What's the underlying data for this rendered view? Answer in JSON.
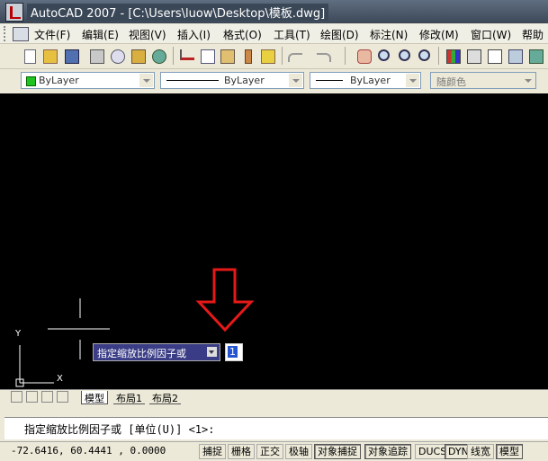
{
  "window": {
    "title": "AutoCAD 2007 - [C:\\Users\\luow\\Desktop\\模板.dwg]"
  },
  "menu": {
    "items": [
      "文件(F)",
      "编辑(E)",
      "视图(V)",
      "插入(I)",
      "格式(O)",
      "工具(T)",
      "绘图(D)",
      "标注(N)",
      "修改(M)",
      "窗口(W)",
      "帮助"
    ]
  },
  "toolbar": {
    "icons": [
      "new-icon",
      "open-icon",
      "save-icon",
      "print-icon",
      "print-preview-icon",
      "publish-icon",
      "3d-dwf-icon",
      "cut-icon",
      "copy-icon",
      "paste-icon",
      "match-properties-icon",
      "block-editor-icon",
      "undo-icon",
      "redo-icon",
      "pan-icon",
      "zoom-realtime-icon",
      "zoom-window-icon",
      "zoom-previous-icon",
      "properties-icon",
      "design-center-icon",
      "tool-palettes-icon",
      "sheet-set-icon",
      "markup-icon",
      "calculator-icon"
    ]
  },
  "properties": {
    "layer": "ByLayer",
    "linetype": "ByLayer",
    "lineweight": "ByLayer",
    "plotstyle": "随颜色",
    "colors": {
      "layer_swatch": "#21c321"
    }
  },
  "canvas": {
    "ucs_x": "X",
    "ucs_y": "Y"
  },
  "tooltip": {
    "prompt": "指定缩放比例因子或",
    "input_value": "1"
  },
  "tabs": {
    "items": [
      "模型",
      "布局1",
      "布局2"
    ]
  },
  "command": {
    "text": "指定缩放比例因子或 [单位(U)] <1>:"
  },
  "status": {
    "coords": "-72.6416, 60.4441 , 0.0000",
    "buttons": [
      "捕捉",
      "栅格",
      "正交",
      "极轴",
      "对象捕捉",
      "对象追踪",
      "DUCS",
      "DYN",
      "线宽",
      "模型"
    ]
  }
}
